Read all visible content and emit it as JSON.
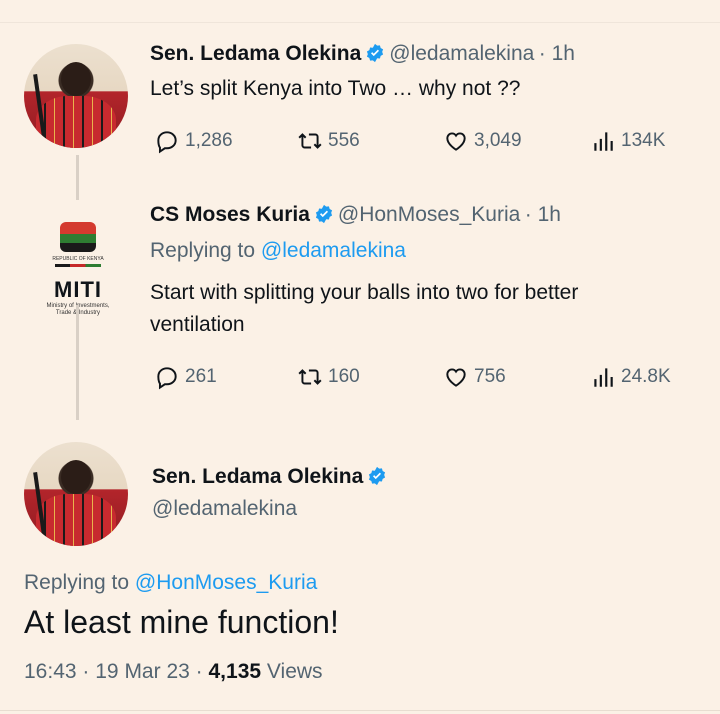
{
  "tweet1": {
    "name": "Sen. Ledama Olekina",
    "handle": "@ledamalekina",
    "time": "· 1h",
    "text": "Let’s split Kenya into Two … why not ??",
    "replies": "1,286",
    "retweets": "556",
    "likes": "3,049",
    "views": "134K"
  },
  "tweet2": {
    "name": "CS Moses Kuria",
    "handle": "@HonMoses_Kuria",
    "time": "· 1h",
    "replying_label": "Replying to ",
    "replying_handle": "@ledamalekina",
    "text_line1": "Start with splitting your balls into two for better",
    "text_line2": "ventilation",
    "replies": "261",
    "retweets": "160",
    "likes": "756",
    "views": "24.8K",
    "logo": {
      "top": "REPUBLIC OF KENYA",
      "title": "MITI",
      "sub1": "Ministry of Investments,",
      "sub2": "Trade & Industry"
    }
  },
  "tweet3": {
    "name": "Sen. Ledama Olekina",
    "handle": "@ledamalekina",
    "replying_label": "Replying to ",
    "replying_handle": "@HonMoses_Kuria",
    "text": "At least mine function!",
    "time": "16:43",
    "date": "19 Mar 23",
    "views_count": "4,135",
    "views_label": "Views"
  },
  "colors": {
    "bg": "#fbf1e6",
    "accent": "#1d9bf0",
    "muted": "#536471"
  },
  "icons": [
    "reply-icon",
    "retweet-icon",
    "like-icon",
    "views-icon",
    "verified-icon"
  ]
}
